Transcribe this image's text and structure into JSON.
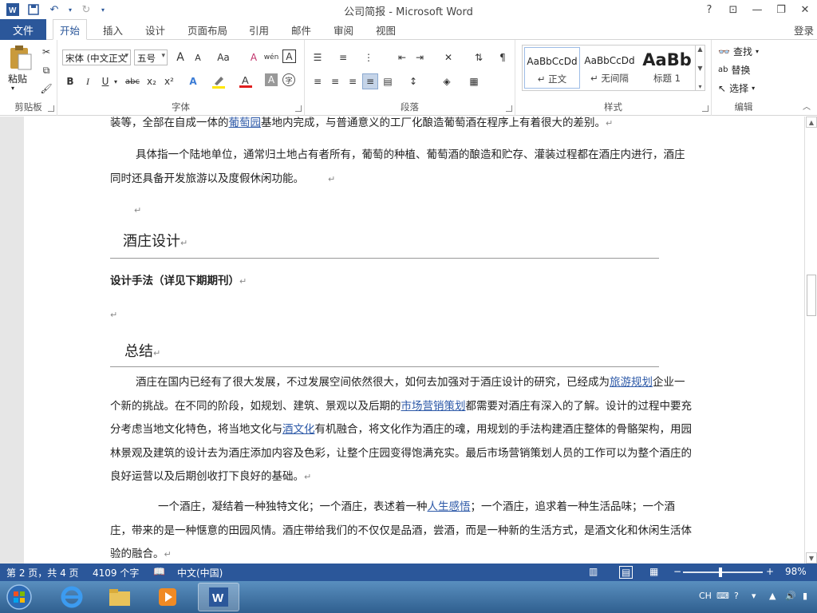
{
  "window": {
    "title": "公司简报 - Microsoft Word",
    "help": "?",
    "login": "登录"
  },
  "qat": {
    "word_icon": "W",
    "save_icon": "save-icon",
    "undo_icon": "undo-icon",
    "redo_icon": "redo-icon"
  },
  "tabs": {
    "file": "文件",
    "items": [
      "开始",
      "插入",
      "设计",
      "页面布局",
      "引用",
      "邮件",
      "审阅",
      "视图"
    ]
  },
  "ribbon": {
    "clipboard": {
      "paste": "粘贴",
      "label": "剪贴板"
    },
    "font": {
      "name": "宋体 (中文正文",
      "size": "五号",
      "label": "字体",
      "b": "B",
      "i": "I",
      "u": "U",
      "strike": "abc",
      "sub": "x₂",
      "sup": "x²",
      "grow": "A",
      "shrink": "A",
      "case": "Aa",
      "clear": "A",
      "pinyin": "wén",
      "border": "A"
    },
    "paragraph": {
      "label": "段落"
    },
    "styles": {
      "label": "样式",
      "items": [
        {
          "sample": "AaBbCcDd",
          "name": "↵ 正文"
        },
        {
          "sample": "AaBbCcDd",
          "name": "↵ 无间隔"
        },
        {
          "sample": "AaBb",
          "name": "标题 1"
        }
      ]
    },
    "editing": {
      "find": "查找",
      "replace": "替换",
      "select": "选择",
      "label": "编辑"
    }
  },
  "document": {
    "line1_pre": "装等，全部在自成一体的",
    "line1_link": "葡萄园",
    "line1_post": "基地内完成，与普通意义的工厂化酿造葡萄酒在程序上有着很大的差别。",
    "para2": "具体指一个陆地单位，通常归土地占有者所有，葡萄的种植、葡萄酒的酿造和贮存、灌装过程都在酒庄内进行，酒庄同时还具备开发旅游以及度假休闲功能。",
    "heading1": "酒庄设计",
    "bold_line": "设计手法（详见下期期刊）",
    "heading2": "总结",
    "para3_a": "酒庄在国内已经有了很大发展，不过发展空间依然很大，如何去加强对于酒庄设计的研究，已经成为",
    "para3_link1": "旅游规划",
    "para3_b": "企业一个新的挑战。在不同的阶段，如规划、建筑、景观以及后期的",
    "para3_link2": "市场营销策划",
    "para3_c": "都需要对酒庄有深入的了解。设计的过程中要充分考虑当地文化特色，将当地文化与",
    "para3_link3": "酒文化",
    "para3_d": "有机融合，将文化作为酒庄的魂，用规划的手法构建酒庄整体的骨骼架构，用园林景观及建筑的设计去为酒庄添加内容及色彩，让整个庄园变得饱满充实。最后市场营销策划人员的工作可以为整个酒庄的良好运营以及后期创收打下良好的基础。",
    "para4_a": "一个酒庄，凝结着一种独特文化；一个酒庄，表述着一种",
    "para4_link": "人生感悟",
    "para4_b": "；一个酒庄，追求着一种生活品味；一个酒庄，带来的是一种惬意的田园风情。酒庄带给我们的不仅仅是品酒，尝酒，而是一种新的生活方式，是酒文化和休闲生活体验的融合。",
    "para_mark": "↵"
  },
  "status": {
    "page": "第 2 页，共 4 页",
    "words": "4109 个字",
    "lang": "中文(中国)",
    "zoom": "98%"
  },
  "taskbar": {
    "ime": "CH"
  },
  "colors": {
    "accent": "#2b579a",
    "link": "#2e5aa8"
  }
}
